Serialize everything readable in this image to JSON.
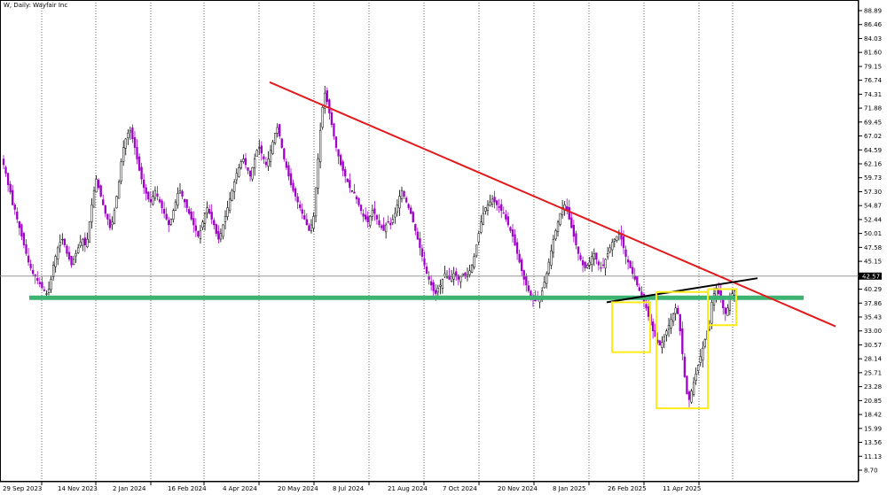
{
  "chart_data": {
    "type": "candlestick",
    "title": "W, Daily:  Wayfair Inc",
    "current_price": "42.57",
    "y_ticks": [
      "88.89",
      "86.46",
      "84.03",
      "81.60",
      "79.15",
      "76.74",
      "74.31",
      "71.88",
      "69.45",
      "67.02",
      "64.59",
      "62.16",
      "59.73",
      "57.30",
      "54.87",
      "52.44",
      "50.01",
      "47.58",
      "45.15",
      "42.72",
      "40.29",
      "37.86",
      "35.43",
      "33.00",
      "30.57",
      "28.14",
      "25.71",
      "23.28",
      "20.85",
      "18.42",
      "15.99",
      "13.56",
      "11.13",
      "8.70"
    ],
    "x_ticks": [
      "29 Sep 2023",
      "14 Nov 2023",
      "2 Jan 2024",
      "16 Feb 2024",
      "4 Apr 2024",
      "20 May 2024",
      "8 Jul 2024",
      "21 Aug 2024",
      "7 Oct 2024",
      "20 Nov 2024",
      "8 Jan 2025",
      "26 Feb 2025",
      "11 Apr 2025"
    ],
    "ylim": [
      8.7,
      88.89
    ],
    "grid": "vertical-dotted",
    "colors": {
      "bull": "#000000",
      "bear": "#a000c8",
      "trendline": "#e31a1c",
      "support": "#3cb371",
      "neckline": "#000000",
      "boxes": "#ffeb1a",
      "price_line": "#888888"
    },
    "candles_close": [
      62.0,
      60.5,
      58.5,
      57.2,
      55.0,
      54.2,
      52.5,
      51.0,
      49.5,
      48.0,
      46.5,
      45.0,
      44.0,
      43.0,
      42.5,
      41.8,
      41.2,
      40.5,
      40.0,
      39.5,
      40.3,
      42.0,
      44.5,
      46.0,
      47.5,
      48.5,
      49.0,
      48.0,
      46.5,
      45.5,
      44.5,
      45.5,
      46.5,
      47.5,
      48.5,
      49.0,
      48.0,
      49.0,
      52.0,
      55.0,
      57.5,
      59.5,
      58.0,
      56.5,
      55.0,
      53.5,
      52.5,
      51.0,
      52.0,
      54.0,
      56.5,
      59.0,
      62.5,
      65.0,
      66.5,
      67.5,
      68.0,
      66.5,
      65.0,
      63.0,
      61.0,
      59.5,
      58.0,
      57.0,
      56.0,
      55.5,
      56.5,
      57.5,
      56.5,
      55.5,
      54.5,
      53.5,
      52.5,
      51.5,
      52.5,
      54.0,
      55.5,
      57.0,
      57.5,
      56.5,
      55.5,
      54.5,
      53.5,
      52.5,
      51.5,
      50.5,
      49.5,
      50.5,
      52.0,
      53.5,
      54.5,
      53.5,
      52.5,
      51.5,
      50.0,
      49.0,
      50.0,
      51.5,
      53.0,
      54.5,
      56.0,
      57.5,
      59.0,
      60.5,
      61.5,
      62.5,
      63.0,
      62.0,
      61.0,
      60.0,
      61.5,
      63.0,
      64.5,
      65.0,
      64.0,
      63.0,
      62.0,
      63.0,
      64.5,
      66.0,
      67.5,
      68.5,
      67.0,
      65.0,
      63.0,
      61.5,
      60.0,
      58.5,
      57.5,
      56.5,
      55.5,
      54.5,
      53.5,
      52.5,
      51.5,
      50.5,
      51.5,
      53.0,
      58.0,
      63.0,
      68.0,
      72.0,
      74.5,
      73.0,
      71.0,
      69.0,
      67.0,
      65.0,
      63.5,
      62.0,
      61.0,
      60.0,
      59.0,
      58.0,
      57.5,
      57.0,
      56.0,
      55.0,
      54.0,
      53.0,
      52.5,
      52.0,
      53.0,
      54.0,
      53.5,
      52.5,
      51.5,
      51.0,
      50.5,
      51.5,
      52.0,
      51.5,
      52.5,
      53.5,
      55.0,
      56.5,
      57.5,
      56.5,
      55.5,
      54.5,
      53.5,
      52.0,
      50.5,
      49.0,
      47.5,
      46.0,
      44.5,
      43.0,
      42.0,
      41.0,
      40.0,
      39.5,
      40.5,
      41.0,
      42.0,
      43.0,
      42.5,
      42.0,
      42.5,
      43.0,
      42.5,
      42.0,
      42.5,
      43.0,
      42.5,
      42.8,
      43.5,
      44.5,
      46.0,
      48.0,
      50.0,
      52.0,
      53.5,
      54.5,
      55.0,
      55.5,
      56.0,
      55.5,
      55.0,
      54.5,
      54.0,
      53.5,
      52.5,
      51.5,
      50.5,
      49.5,
      48.0,
      46.5,
      45.0,
      43.5,
      42.0,
      41.0,
      40.0,
      39.0,
      38.5,
      38.2,
      38.5,
      39.0,
      40.0,
      41.5,
      43.0,
      45.0,
      47.0,
      49.0,
      50.5,
      52.0,
      53.5,
      54.5,
      55.0,
      54.0,
      52.5,
      51.0,
      49.5,
      48.0,
      46.5,
      45.5,
      44.5,
      44.0,
      44.5,
      45.0,
      46.0,
      46.5,
      45.5,
      44.5,
      44.0,
      44.5,
      45.5,
      46.5,
      47.5,
      48.5,
      49.0,
      49.5,
      50.0,
      49.0,
      47.5,
      46.0,
      45.0,
      44.0,
      43.0,
      42.0,
      41.0,
      40.0,
      39.0,
      38.0,
      37.0,
      35.5,
      34.0,
      33.0,
      32.0,
      31.0,
      30.5,
      31.0,
      32.0,
      33.0,
      34.0,
      35.0,
      36.0,
      37.0,
      36.0,
      33.0,
      29.0,
      25.0,
      22.0,
      21.0,
      22.5,
      24.0,
      25.5,
      27.0,
      28.5,
      30.0,
      31.5,
      33.0,
      34.0,
      38.0,
      39.5,
      40.5,
      39.5,
      38.5,
      37.0,
      36.0,
      37.0,
      38.5,
      39.5,
      40.0
    ],
    "annotations": {
      "red_trendline": {
        "from": {
          "date": "May 2024",
          "price": 76.4
        },
        "to": {
          "date": "Jun 2025",
          "price": 33.8
        }
      },
      "green_support_price": 38.8,
      "black_neckline": {
        "from": {
          "date": "Feb 2025",
          "price": 38.0
        },
        "to": {
          "date": "May 2025",
          "price": 42.2
        }
      },
      "yellow_boxes": [
        {
          "top": 38.0,
          "bottom": 29.3
        },
        {
          "top": 39.8,
          "bottom": 19.5
        },
        {
          "top": 40.3,
          "bottom": 34.0
        }
      ]
    }
  }
}
